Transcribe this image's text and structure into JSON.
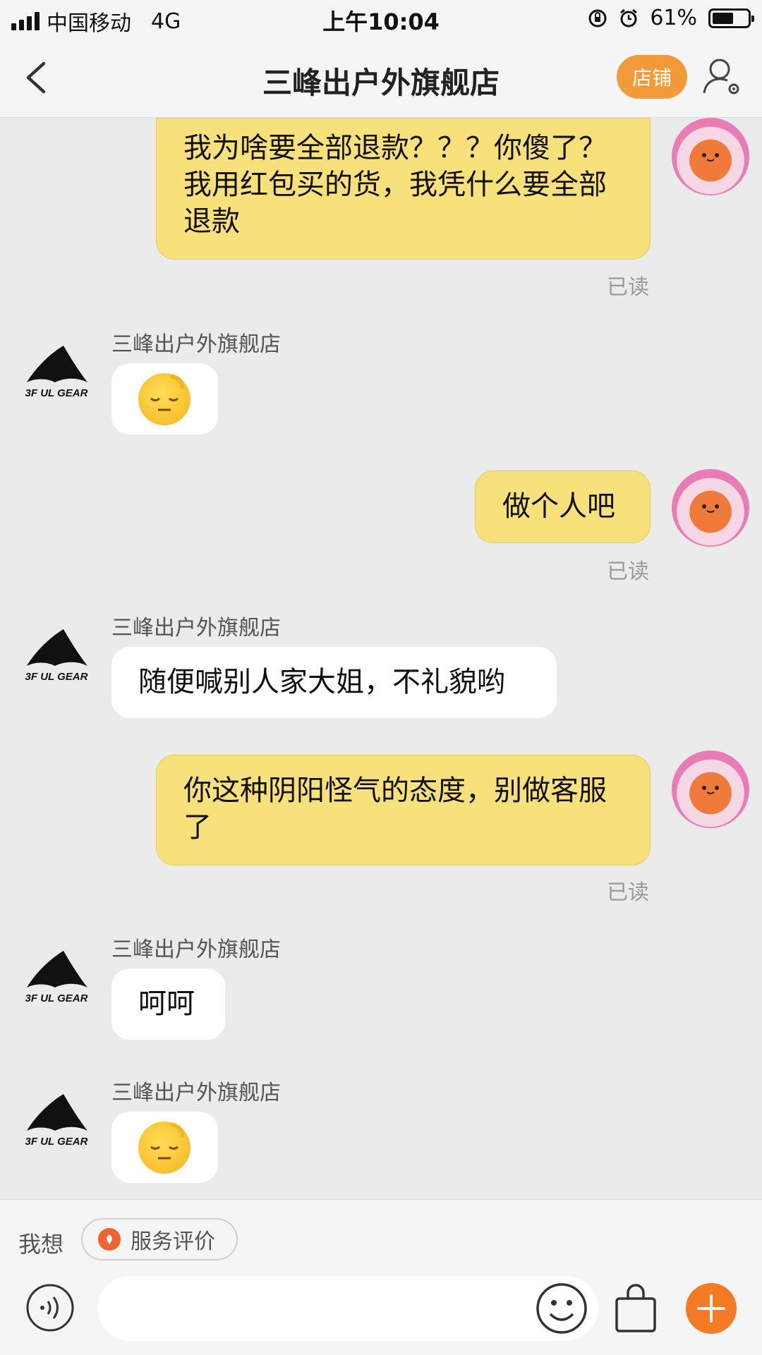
{
  "status_bar": {
    "carrier": "中国移动",
    "network": "4G",
    "time": "上午10:04",
    "battery": "61%",
    "battery_level": 0.61
  },
  "nav": {
    "title": "三峰出户外旗舰店",
    "shop_button": "店铺"
  },
  "messages": {
    "m1": {
      "text": "我为啥要全部退款？？？你傻了？我用红包买的货，我凭什么要全部退款",
      "status": "已读"
    },
    "m2": {
      "sender": "三峰出户外旗舰店"
    },
    "m3": {
      "text": "做个人吧",
      "status": "已读"
    },
    "m4": {
      "sender": "三峰出户外旗舰店",
      "text": "随便喊别人家大姐，不礼貌哟"
    },
    "m5": {
      "text": "你这种阴阳怪气的态度，别做客服了",
      "status": "已读"
    },
    "m6": {
      "sender": "三峰出户外旗舰店",
      "text": "呵呵"
    },
    "m7": {
      "sender": "三峰出户外旗舰店"
    }
  },
  "shop_logo_text": "3F UL GEAR",
  "bottom": {
    "want_label": "我想",
    "review_chip": "服务评价",
    "input_placeholder": ""
  },
  "colors": {
    "outgoing_bubble": "#f8e17a",
    "incoming_bubble": "#ffffff",
    "accent_orange": "#f39a3b",
    "background": "#ebebeb"
  },
  "icons": [
    "back-chevron-icon",
    "profile-settings-icon",
    "voice-icon",
    "emoji-icon",
    "shopping-bag-icon",
    "plus-icon",
    "sleepy-face-emoji"
  ]
}
